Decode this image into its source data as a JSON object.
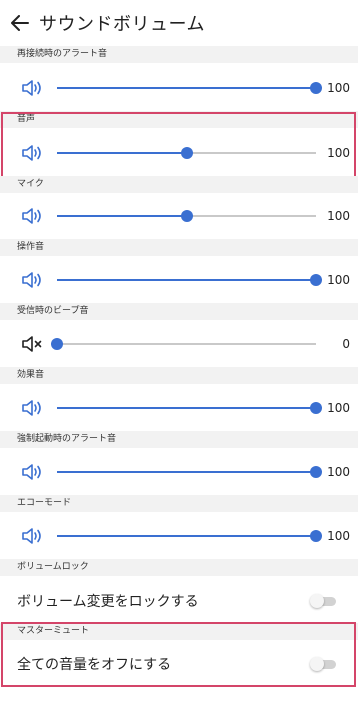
{
  "header": {
    "title": "サウンドボリューム",
    "back_icon": "arrow-left-icon"
  },
  "colors": {
    "accent": "#3a6fd1",
    "highlight": "#d44569",
    "track": "#c9c9c9"
  },
  "volumes": [
    {
      "label": "再接続時のアラート音",
      "value": "100",
      "level": 1.0,
      "muted": false
    },
    {
      "label": "音声",
      "value": "100",
      "level": 0.5,
      "muted": false
    },
    {
      "label": "マイク",
      "value": "100",
      "level": 0.5,
      "muted": false
    },
    {
      "label": "操作音",
      "value": "100",
      "level": 1.0,
      "muted": false
    },
    {
      "label": "受信時のビープ音",
      "value": "0",
      "level": 0.0,
      "muted": true
    },
    {
      "label": "効果音",
      "value": "100",
      "level": 1.0,
      "muted": false
    },
    {
      "label": "強制起動時のアラート音",
      "value": "100",
      "level": 1.0,
      "muted": false
    },
    {
      "label": "エコーモード",
      "value": "100",
      "level": 1.0,
      "muted": false
    }
  ],
  "lock": {
    "section": "ボリュームロック",
    "label": "ボリューム変更をロックする",
    "on": false
  },
  "master": {
    "section": "マスターミュート",
    "label": "全ての音量をオフにする",
    "on": false
  }
}
